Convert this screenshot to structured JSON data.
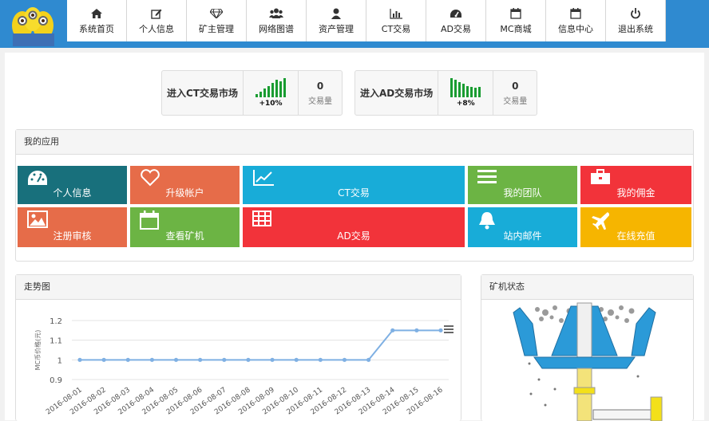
{
  "nav": [
    {
      "label": "系统首页",
      "icon": "home-icon"
    },
    {
      "label": "个人信息",
      "icon": "edit-icon"
    },
    {
      "label": "矿主管理",
      "icon": "diamond-icon"
    },
    {
      "label": "网络图谱",
      "icon": "users-icon"
    },
    {
      "label": "资产管理",
      "icon": "user-icon"
    },
    {
      "label": "CT交易",
      "icon": "bar-chart-icon"
    },
    {
      "label": "AD交易",
      "icon": "dashboard-icon"
    },
    {
      "label": "MC商城",
      "icon": "calendar-icon"
    },
    {
      "label": "信息中心",
      "icon": "calendar-icon"
    },
    {
      "label": "退出系统",
      "icon": "power-icon"
    }
  ],
  "markets": [
    {
      "title": "进入CT交易市场",
      "pct": "+10%",
      "volume": "0",
      "volume_label": "交易量",
      "bar_levels": [
        0.15,
        0.3,
        0.45,
        0.6,
        0.75,
        0.9,
        0.85,
        1.0
      ]
    },
    {
      "title": "进入AD交易市场",
      "pct": "+8%",
      "volume": "0",
      "volume_label": "交易量",
      "bar_levels": [
        1.0,
        0.9,
        0.8,
        0.7,
        0.6,
        0.55,
        0.5,
        0.55
      ]
    }
  ],
  "apps": {
    "title": "我的应用",
    "tiles": [
      {
        "label": "个人信息",
        "icon": "dashboard-icon",
        "color": "#18707c"
      },
      {
        "label": "升级帐户",
        "icon": "heart-icon",
        "color": "#e66c49"
      },
      {
        "label": "CT交易",
        "icon": "line-chart-icon",
        "color": "#18acd8"
      },
      {
        "label": "我的团队",
        "icon": "list-icon",
        "color": "#6cb444"
      },
      {
        "label": "我的佣金",
        "icon": "briefcase-icon",
        "color": "#f2333a"
      },
      {
        "label": "注册审核",
        "icon": "picture-icon",
        "color": "#e66c49"
      },
      {
        "label": "查看矿机",
        "icon": "calendar-icon",
        "color": "#6cb444"
      },
      {
        "label": "AD交易",
        "icon": "table-icon",
        "color": "#f2333a"
      },
      {
        "label": "站内邮件",
        "icon": "bell-icon",
        "color": "#18acd8"
      },
      {
        "label": "在线充值",
        "icon": "plane-icon",
        "color": "#f6b500"
      }
    ]
  },
  "trend": {
    "title": "走势图",
    "menu_icon": "menu-icon"
  },
  "miner": {
    "title": "矿机状态",
    "image": "crusher-machine-illustration"
  },
  "chart_data": {
    "type": "line",
    "x": [
      "2016-08-01",
      "2016-08-02",
      "2016-08-03",
      "2016-08-04",
      "2016-08-05",
      "2016-08-06",
      "2016-08-07",
      "2016-08-08",
      "2016-08-09",
      "2016-08-10",
      "2016-08-11",
      "2016-08-12",
      "2016-08-13",
      "2016-08-14",
      "2016-08-15",
      "2016-08-16"
    ],
    "series": [
      {
        "values": [
          1,
          1,
          1,
          1,
          1,
          1,
          1,
          1,
          1,
          1,
          1,
          1,
          1,
          1.15,
          1.15,
          1.15
        ]
      }
    ],
    "ylabel": "MC币价格(元)",
    "yticks": [
      "1.2",
      "1.1",
      "1",
      "0.9"
    ],
    "ylim": [
      0.9,
      1.2
    ],
    "grid": true,
    "color": "#7fb0e3"
  }
}
